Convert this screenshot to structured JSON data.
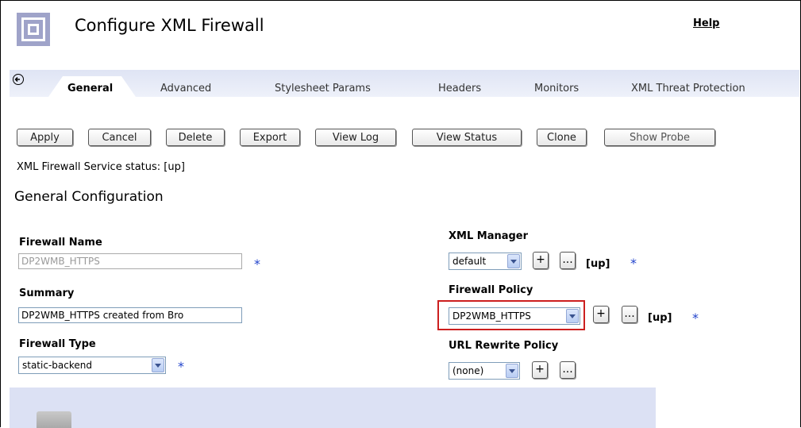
{
  "header": {
    "title": "Configure XML Firewall",
    "help": "Help"
  },
  "tabs": [
    {
      "label": "General",
      "active": true
    },
    {
      "label": "Advanced"
    },
    {
      "label": "Stylesheet Params"
    },
    {
      "label": "Headers"
    },
    {
      "label": "Monitors"
    },
    {
      "label": "XML Threat Protection"
    }
  ],
  "toolbar": {
    "apply": "Apply",
    "cancel": "Cancel",
    "delete": "Delete",
    "export": "Export",
    "view_log": "View Log",
    "view_status": "View Status",
    "clone": "Clone",
    "show_probe": "Show Probe"
  },
  "status": "XML Firewall Service status: [up]",
  "section_title": "General Configuration",
  "form": {
    "firewall_name": {
      "label": "Firewall Name",
      "value": "DP2WMB_HTTPS"
    },
    "summary": {
      "label": "Summary",
      "value": "DP2WMB_HTTPS created from Bro"
    },
    "firewall_type": {
      "label": "Firewall Type",
      "value": "static-backend"
    },
    "xml_manager": {
      "label": "XML Manager",
      "value": "default",
      "status": "[up]"
    },
    "firewall_policy": {
      "label": "Firewall Policy",
      "value": "DP2WMB_HTTPS",
      "status": "[up]"
    },
    "url_rewrite_policy": {
      "label": "URL Rewrite Policy",
      "value": "(none)"
    },
    "required_marker": "*",
    "add": "+",
    "browse": "..."
  },
  "colors": {
    "required": "#2244cc",
    "highlight": "#cc1f1f",
    "tab_band": "#dfe4f4"
  }
}
